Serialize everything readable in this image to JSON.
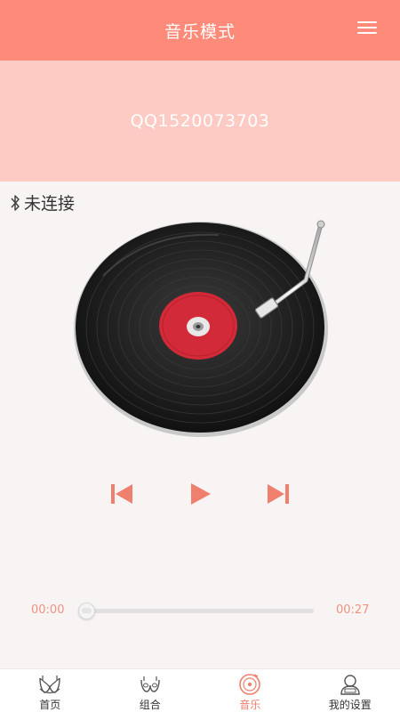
{
  "header": {
    "title": "音乐模式",
    "menu_icon": "hamburger-menu-icon"
  },
  "banner": {
    "text": "QQ1520073703"
  },
  "bluetooth": {
    "icon": "bluetooth-icon",
    "status": "未连接"
  },
  "player": {
    "elapsed": "00:00",
    "duration": "00:27",
    "progress": 0,
    "controls": [
      "previous-track-icon",
      "play-icon",
      "next-track-icon"
    ]
  },
  "tabs": [
    {
      "label": "首页",
      "icon": "bra-icon",
      "active": false
    },
    {
      "label": "组合",
      "icon": "bra-outline-icon",
      "active": false
    },
    {
      "label": "音乐",
      "icon": "music-disc-icon",
      "active": true
    },
    {
      "label": "我的设置",
      "icon": "profile-icon",
      "active": false
    }
  ],
  "colors": {
    "header_bg": "#fe8a79",
    "banner_bg": "#fecbc4",
    "accent": "#f0806e",
    "background": "#f8f4f4",
    "record_label": "#d22a38"
  }
}
